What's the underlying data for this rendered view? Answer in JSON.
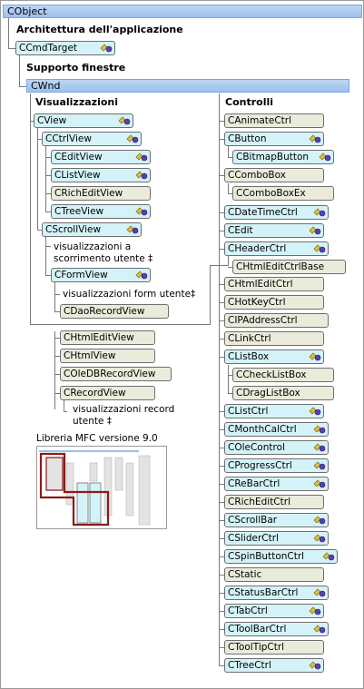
{
  "top_bar": "CObject",
  "headers": {
    "app_arch": "Architettura dell'applicazione",
    "window_support": "Supporto finestre",
    "views": "Visualizzazioni",
    "controls": "Controlli"
  },
  "cwnd_bar": "CWnd",
  "cmdtarget": "CCmdTarget",
  "views": {
    "cview": "CView",
    "cctrlview": "CCtrlView",
    "ceditview": "CEditView",
    "clistview": "CListView",
    "crichedit": "CRichEditView",
    "ctreeview": "CTreeView",
    "cscrollview": "CScrollView",
    "scroll_note_1": "visualizzazioni a",
    "scroll_note_2": "scorrimento utente ‡",
    "cformview": "CFormView",
    "form_note": "visualizzazioni form utente‡",
    "cdaorecordview": "CDaoRecordView",
    "chtmleditview": "CHtmlEditView",
    "chtmlview": "CHtmlView",
    "coledb": "COleDBRecordView",
    "crecordview": "CRecordView",
    "record_note_1": "visualizzazioni record",
    "record_note_2": "utente ‡"
  },
  "thumb_caption": "Libreria MFC versione 9.0",
  "controls": [
    "CAnimateCtrl",
    "CButton",
    "CBitmapButton",
    "CComboBox",
    "CComboBoxEx",
    "CDateTimeCtrl",
    "CEdit",
    "CHeaderCtrl",
    "CHtmlEditCtrlBase",
    "CHtmlEditCtrl",
    "CHotKeyCtrl",
    "CIPAddressCtrl",
    "CLinkCtrl",
    "CListBox",
    "CCheckListBox",
    "CDragListBox",
    "CListCtrl",
    "CMonthCalCtrl",
    "COleControl",
    "CProgressCtrl",
    "CReBarCtrl",
    "CRichEditCtrl",
    "CScrollBar",
    "CSliderCtrl",
    "CSpinButtonCtrl",
    "CStatic",
    "CStatusBarCtrl",
    "CTabCtrl",
    "CToolBarCtrl",
    "CToolTipCtrl",
    "CTreeCtrl"
  ],
  "colors": {
    "bar": "#9cc0ee",
    "cyan_box": "#d4f3f8",
    "gray_box": "#ebebdc",
    "highlight": "#8b1a1a"
  }
}
